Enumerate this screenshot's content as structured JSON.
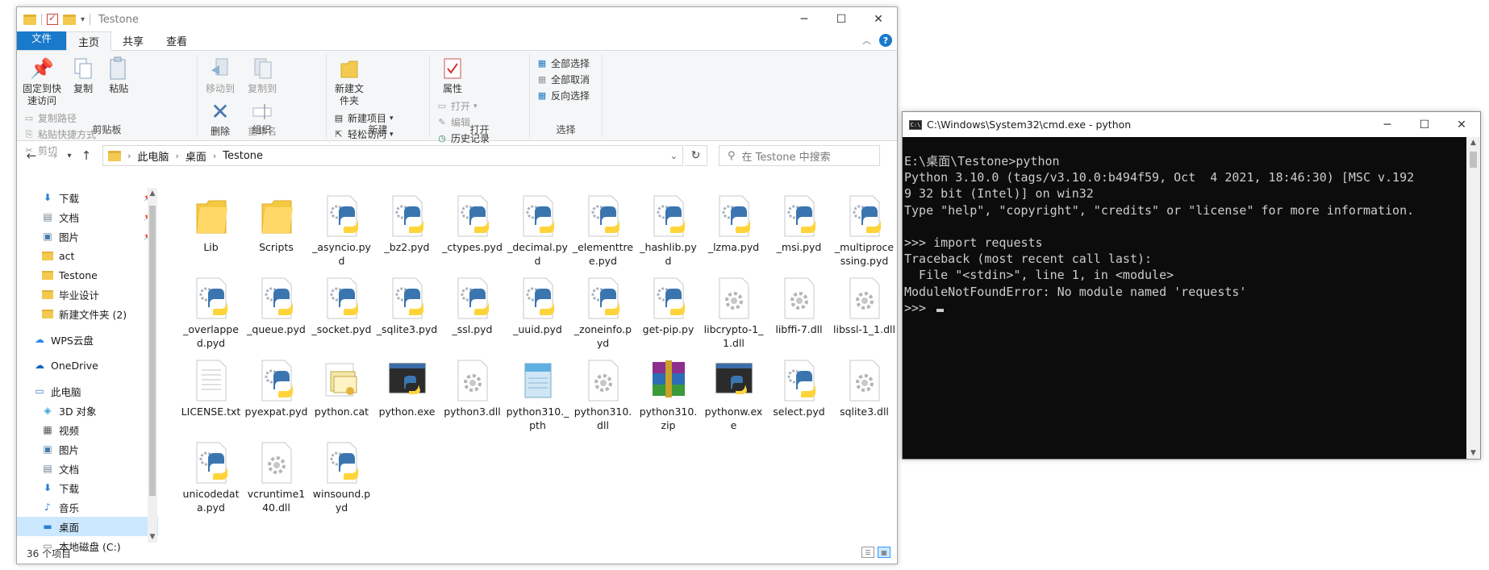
{
  "explorer": {
    "title": "Testone",
    "tabs": [
      "文件",
      "主页",
      "共享",
      "查看"
    ],
    "ribbon": {
      "clipboard": {
        "label": "剪贴板",
        "pin": "固定到快速访问",
        "copy": "复制",
        "paste": "粘贴",
        "copy_path": "复制路径",
        "paste_shortcut": "粘贴快捷方式",
        "cut": "剪切"
      },
      "organize": {
        "label": "组织",
        "move_to": "移动到",
        "copy_to": "复制到",
        "delete": "删除",
        "rename": "重命名"
      },
      "new": {
        "label": "新建",
        "new_folder": "新建文件夹",
        "new_item": "新建项目",
        "easy_access": "轻松访问"
      },
      "open": {
        "label": "打开",
        "properties": "属性",
        "open": "打开",
        "edit": "编辑",
        "history": "历史记录"
      },
      "select": {
        "label": "选择",
        "select_all": "全部选择",
        "select_none": "全部取消",
        "invert": "反向选择"
      }
    },
    "address": {
      "crumbs": [
        "此电脑",
        "桌面",
        "Testone"
      ]
    },
    "search_placeholder": "在 Testone 中搜索",
    "nav_items": [
      {
        "label": "下载",
        "icon": "download-icon",
        "pinned": true
      },
      {
        "label": "文档",
        "icon": "document-icon",
        "pinned": true
      },
      {
        "label": "图片",
        "icon": "picture-icon",
        "pinned": true
      },
      {
        "label": "act",
        "icon": "folder-icon",
        "pinned": false
      },
      {
        "label": "Testone",
        "icon": "folder-icon",
        "pinned": false
      },
      {
        "label": "毕业设计",
        "icon": "folder-icon",
        "pinned": false
      },
      {
        "label": "新建文件夹 (2)",
        "icon": "folder-icon",
        "pinned": false
      },
      {
        "label": "WPS云盘",
        "icon": "cloud-icon",
        "pinned": false
      },
      {
        "label": "OneDrive",
        "icon": "onedrive-icon",
        "pinned": false
      },
      {
        "label": "此电脑",
        "icon": "computer-icon",
        "pinned": false
      },
      {
        "label": "3D 对象",
        "icon": "3d-objects-icon",
        "pinned": false
      },
      {
        "label": "视频",
        "icon": "video-icon",
        "pinned": false
      },
      {
        "label": "图片",
        "icon": "picture-icon",
        "pinned": false
      },
      {
        "label": "文档",
        "icon": "document-icon",
        "pinned": false
      },
      {
        "label": "下载",
        "icon": "download-icon",
        "pinned": false
      },
      {
        "label": "音乐",
        "icon": "music-icon",
        "pinned": false
      },
      {
        "label": "桌面",
        "icon": "desktop-icon",
        "pinned": false,
        "selected": true
      },
      {
        "label": "本地磁盘 (C:)",
        "icon": "drive-icon",
        "pinned": false
      }
    ],
    "files": [
      {
        "name": "Lib",
        "type": "folder"
      },
      {
        "name": "Scripts",
        "type": "folder"
      },
      {
        "name": "_asyncio.pyd",
        "type": "pyd"
      },
      {
        "name": "_bz2.pyd",
        "type": "pyd"
      },
      {
        "name": "_ctypes.pyd",
        "type": "pyd"
      },
      {
        "name": "_decimal.pyd",
        "type": "pyd"
      },
      {
        "name": "_elementtree.pyd",
        "type": "pyd"
      },
      {
        "name": "_hashlib.pyd",
        "type": "pyd"
      },
      {
        "name": "_lzma.pyd",
        "type": "pyd"
      },
      {
        "name": "_msi.pyd",
        "type": "pyd"
      },
      {
        "name": "_multiprocessing.pyd",
        "type": "pyd"
      },
      {
        "name": "_overlapped.pyd",
        "type": "pyd"
      },
      {
        "name": "_queue.pyd",
        "type": "pyd"
      },
      {
        "name": "_socket.pyd",
        "type": "pyd"
      },
      {
        "name": "_sqlite3.pyd",
        "type": "pyd"
      },
      {
        "name": "_ssl.pyd",
        "type": "pyd"
      },
      {
        "name": "_uuid.pyd",
        "type": "pyd"
      },
      {
        "name": "_zoneinfo.pyd",
        "type": "pyd"
      },
      {
        "name": "get-pip.py",
        "type": "py"
      },
      {
        "name": "libcrypto-1_1.dll",
        "type": "dll"
      },
      {
        "name": "libffi-7.dll",
        "type": "dll"
      },
      {
        "name": "libssl-1_1.dll",
        "type": "dll"
      },
      {
        "name": "LICENSE.txt",
        "type": "txt"
      },
      {
        "name": "pyexpat.pyd",
        "type": "pyd"
      },
      {
        "name": "python.cat",
        "type": "cat"
      },
      {
        "name": "python.exe",
        "type": "exe"
      },
      {
        "name": "python3.dll",
        "type": "dll"
      },
      {
        "name": "python310._pth",
        "type": "pth"
      },
      {
        "name": "python310.dll",
        "type": "dll"
      },
      {
        "name": "python310.zip",
        "type": "zip"
      },
      {
        "name": "pythonw.exe",
        "type": "exe"
      },
      {
        "name": "select.pyd",
        "type": "pyd"
      },
      {
        "name": "sqlite3.dll",
        "type": "dll"
      },
      {
        "name": "unicodedata.pyd",
        "type": "pyd"
      },
      {
        "name": "vcruntime140.dll",
        "type": "dll"
      },
      {
        "name": "winsound.pyd",
        "type": "pyd"
      }
    ],
    "status": "36 个项目"
  },
  "cmd": {
    "title": "C:\\Windows\\System32\\cmd.exe - python",
    "lines": [
      "E:\\桌面\\Testone>python",
      "Python 3.10.0 (tags/v3.10.0:b494f59, Oct  4 2021, 18:46:30) [MSC v.192",
      "9 32 bit (Intel)] on win32",
      "Type \"help\", \"copyright\", \"credits\" or \"license\" for more information.",
      "",
      ">>> import requests",
      "Traceback (most recent call last):",
      "  File \"<stdin>\", line 1, in <module>",
      "ModuleNotFoundError: No module named 'requests'",
      ">>> "
    ]
  },
  "colors": {
    "accent": "#1979ca",
    "console_bg": "#0c0c0c",
    "console_fg": "#cccccc",
    "selected": "#cce8ff"
  }
}
